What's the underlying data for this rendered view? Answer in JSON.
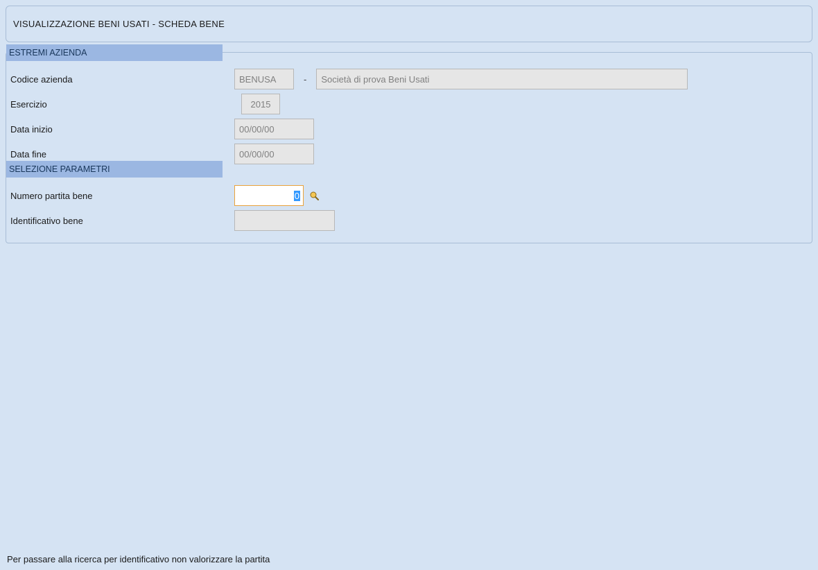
{
  "header": {
    "title": "VISUALIZZAZIONE BENI USATI - SCHEDA BENE"
  },
  "sections": {
    "azienda": {
      "heading": "ESTREMI AZIENDA",
      "codice_label": "Codice azienda",
      "codice_value": "BENUSA",
      "separator": "-",
      "desc_value": "Società di prova Beni Usati",
      "esercizio_label": "Esercizio",
      "esercizio_value": "2015",
      "data_inizio_label": "Data inizio",
      "data_inizio_value": "00/00/00",
      "data_fine_label": "Data fine",
      "data_fine_value": "00/00/00"
    },
    "parametri": {
      "heading": "SELEZIONE PARAMETRI",
      "numero_partita_label": "Numero partita bene",
      "numero_partita_value": "0",
      "identificativo_label": "Identificativo bene",
      "identificativo_value": ""
    }
  },
  "footer": {
    "hint": "Per passare alla ricerca per identificativo non valorizzare la partita"
  }
}
